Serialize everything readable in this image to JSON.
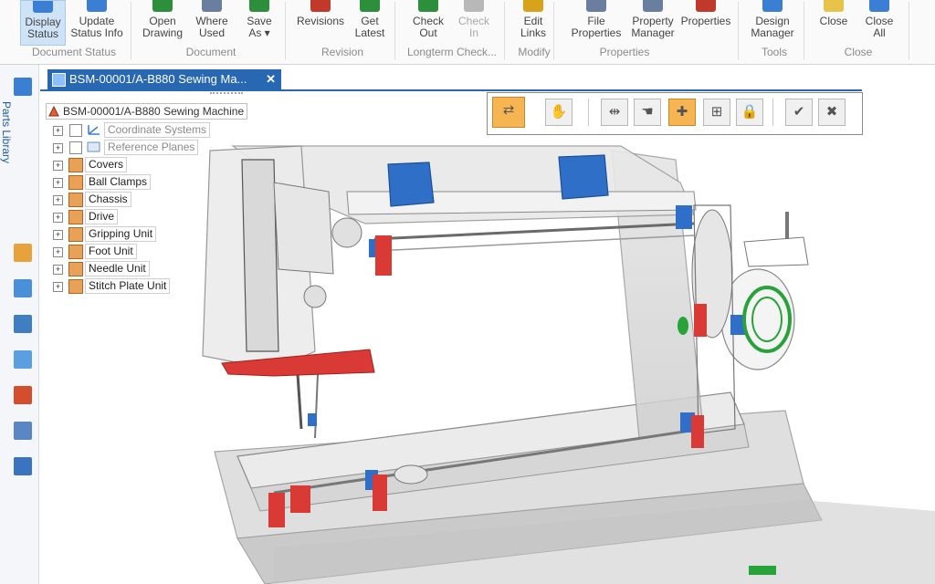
{
  "ribbon": {
    "buttons": [
      {
        "label1": "Display",
        "label2": "Status",
        "active": true,
        "disabled": false,
        "color": "#3b7fd4"
      },
      {
        "label1": "Update",
        "label2": "Status Info",
        "active": false,
        "disabled": false,
        "color": "#3b7fd4"
      },
      {
        "label1": "Open",
        "label2": "Drawing",
        "active": false,
        "disabled": false,
        "color": "#2d8f3c"
      },
      {
        "label1": "Where",
        "label2": "Used",
        "active": false,
        "disabled": false,
        "color": "#6a7fa0"
      },
      {
        "label1": "Save",
        "label2": "As ▾",
        "active": false,
        "disabled": false,
        "color": "#2d8f3c"
      },
      {
        "label1": "Revisions",
        "label2": "",
        "active": false,
        "disabled": false,
        "color": "#c0392b"
      },
      {
        "label1": "Get",
        "label2": "Latest",
        "active": false,
        "disabled": false,
        "color": "#2d8f3c"
      },
      {
        "label1": "Check",
        "label2": "Out",
        "active": false,
        "disabled": false,
        "color": "#2d8f3c"
      },
      {
        "label1": "Check",
        "label2": "In",
        "active": false,
        "disabled": true,
        "color": "#b8b8b8"
      },
      {
        "label1": "Edit",
        "label2": "Links",
        "active": false,
        "disabled": false,
        "color": "#d9a21b"
      },
      {
        "label1": "File",
        "label2": "Properties",
        "active": false,
        "disabled": false,
        "color": "#6a7fa0"
      },
      {
        "label1": "Property",
        "label2": "Manager",
        "active": false,
        "disabled": false,
        "color": "#6a7fa0"
      },
      {
        "label1": "Properties",
        "label2": "",
        "active": false,
        "disabled": false,
        "color": "#c0392b"
      },
      {
        "label1": "Design",
        "label2": "Manager",
        "active": false,
        "disabled": false,
        "color": "#3b7fd4"
      },
      {
        "label1": "Close",
        "label2": "",
        "active": false,
        "disabled": false,
        "color": "#e8c34a"
      },
      {
        "label1": "Close",
        "label2": "All",
        "active": false,
        "disabled": false,
        "color": "#3b7fd4"
      }
    ],
    "groups": [
      "Document Status",
      "Document",
      "Revision",
      "Longterm Check...",
      "Modify",
      "Properties",
      "Tools",
      "Close"
    ]
  },
  "sidebar": {
    "title": "Parts Library"
  },
  "tab": {
    "title": "BSM-00001/A-B880 Sewing Ma...",
    "close": "✕"
  },
  "tree": {
    "root": "BSM-00001/A-B880 Sewing Machine",
    "items": [
      {
        "label": "Coordinate Systems",
        "kind": "system"
      },
      {
        "label": "Reference Planes",
        "kind": "system"
      },
      {
        "label": "Covers",
        "kind": "assembly"
      },
      {
        "label": "Ball Clamps",
        "kind": "assembly"
      },
      {
        "label": "Chassis",
        "kind": "assembly"
      },
      {
        "label": "Drive",
        "kind": "assembly"
      },
      {
        "label": "Gripping Unit",
        "kind": "assembly"
      },
      {
        "label": "Foot Unit",
        "kind": "assembly"
      },
      {
        "label": "Needle Unit",
        "kind": "assembly"
      },
      {
        "label": "Stitch Plate Unit",
        "kind": "assembly"
      }
    ]
  },
  "colors": {
    "accent": "#2867b2",
    "highlight": "#f6b552",
    "part_red": "#d93a35",
    "part_blue": "#2f6fc7",
    "part_green": "#27a33a"
  }
}
